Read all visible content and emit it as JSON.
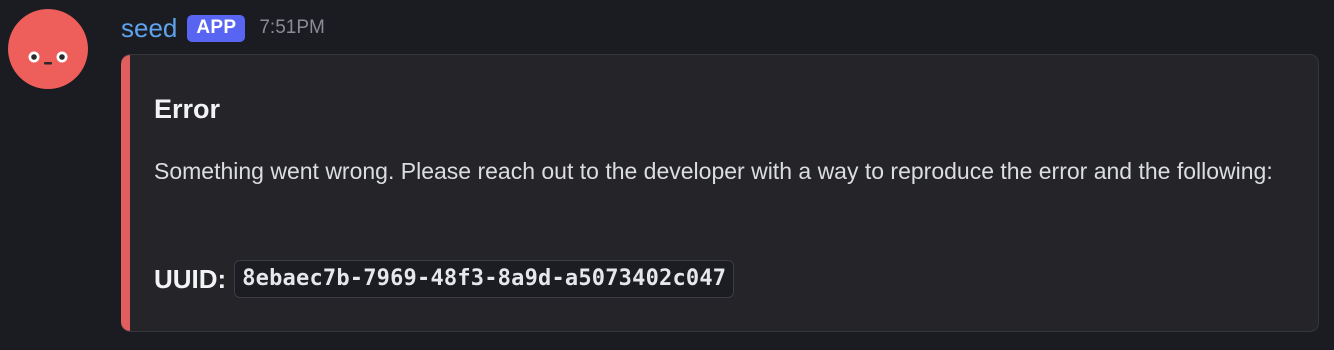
{
  "message": {
    "author": {
      "username": "seed",
      "badge": "APP",
      "avatar_icon": "blob-face-icon",
      "avatar_color": "#ee5f5b",
      "username_color": "#5ea3ec"
    },
    "timestamp": "7:51PM",
    "embed": {
      "accent_color": "#e05e5e",
      "title": "Error",
      "description": "Something went wrong. Please reach out to the developer with a way to reproduce the error and the following:",
      "uuid_label": "UUID:",
      "uuid_value": "8ebaec7b-7969-48f3-8a9d-a5073402c047"
    }
  },
  "theme": {
    "background": "#1b1b22",
    "embed_background": "#242429",
    "badge_color": "#5865f2"
  }
}
